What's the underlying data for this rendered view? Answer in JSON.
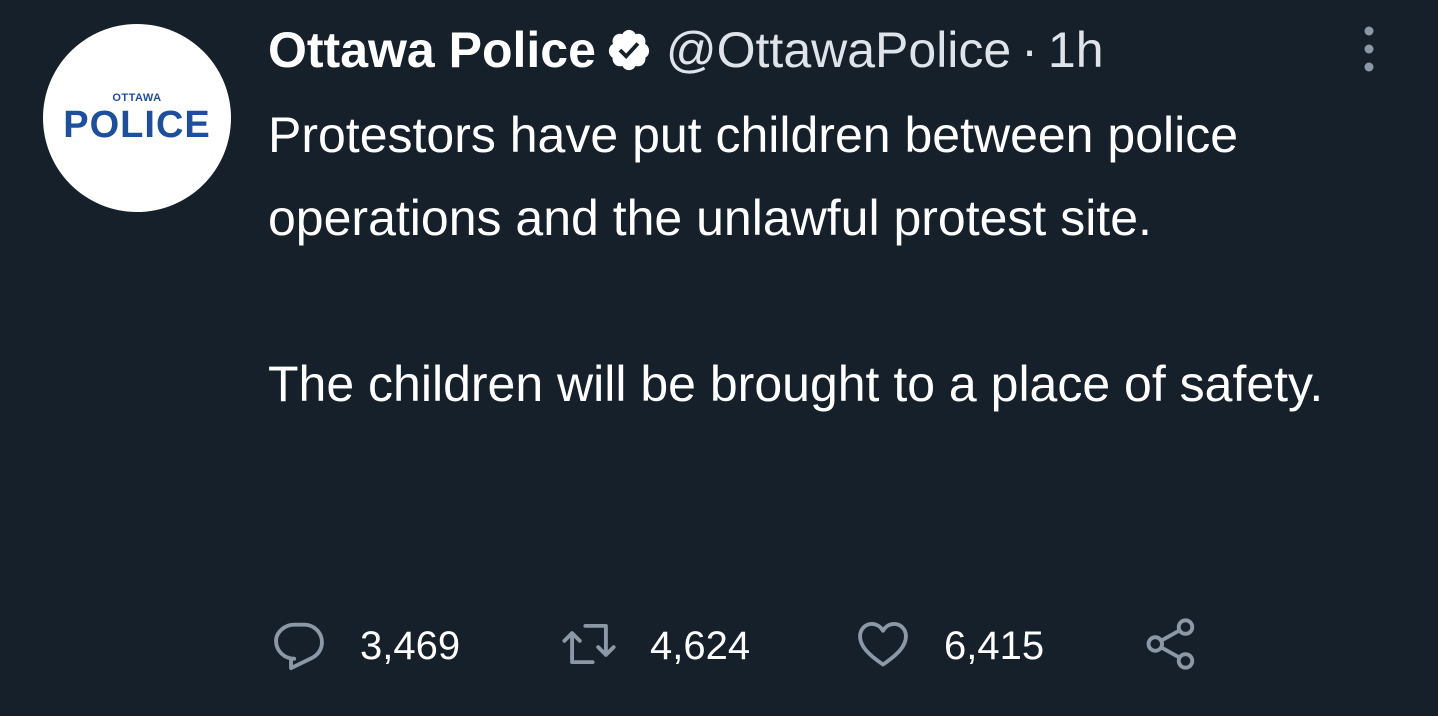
{
  "tweet": {
    "avatar": {
      "logo_small": "OTTAWA",
      "logo_big": "POLICE"
    },
    "author": {
      "display_name": "Ottawa Police",
      "verified": true,
      "handle": "@OttawaPolice",
      "separator": "·",
      "time": "1h"
    },
    "text": {
      "paragraph_1": "Protestors have put children between police operations and the unlawful protest site.",
      "paragraph_2": "The children will be brought to a place of safety."
    },
    "actions": {
      "reply_count": "3,469",
      "retweet_count": "4,624",
      "like_count": "6,415"
    },
    "icons": {
      "verified": "verified-badge-icon",
      "more": "more-options-icon",
      "reply": "reply-icon",
      "retweet": "retweet-icon",
      "like": "heart-icon",
      "share": "share-icon"
    },
    "colors": {
      "background": "#16202b",
      "text": "#ffffff",
      "icon": "#8b98a5",
      "logo": "#1e4f9c"
    }
  }
}
